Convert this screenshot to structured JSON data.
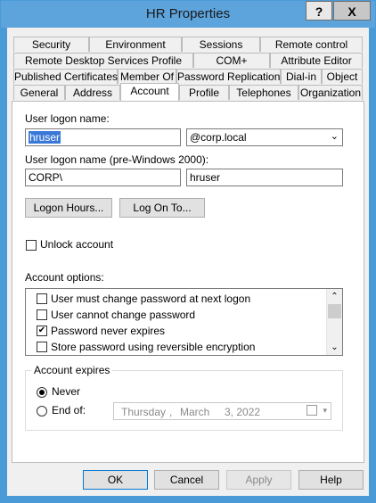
{
  "window": {
    "title": "HR Properties",
    "help_label": "?",
    "close_label": "X"
  },
  "tabs": {
    "row1": [
      "Security",
      "Environment",
      "Sessions",
      "Remote control"
    ],
    "row2": [
      "Remote Desktop Services Profile",
      "COM+",
      "Attribute Editor"
    ],
    "row3": [
      "Published Certificates",
      "Member Of",
      "Password Replication",
      "Dial-in",
      "Object"
    ],
    "row4": [
      "General",
      "Address",
      "Account",
      "Profile",
      "Telephones",
      "Organization"
    ],
    "active": "Account"
  },
  "account": {
    "logon_name_label": "User logon name:",
    "logon_name_value": "hruser",
    "domain_value": "@corp.local",
    "pre2000_label": "User logon name (pre-Windows 2000):",
    "pre2000_domain": "CORP\\",
    "pre2000_user": "hruser",
    "logon_hours_label": "Logon Hours...",
    "log_on_to_label": "Log On To...",
    "unlock_label": "Unlock account",
    "options_label": "Account options:",
    "options": [
      {
        "label": "User must change password at next logon",
        "checked": false
      },
      {
        "label": "User cannot change password",
        "checked": false
      },
      {
        "label": "Password never expires",
        "checked": true
      },
      {
        "label": "Store password using reversible encryption",
        "checked": false
      }
    ],
    "expires_label": "Account expires",
    "never_label": "Never",
    "end_of_label": "End of:",
    "date": {
      "weekday": "Thursday",
      "sep": ",",
      "month": "March",
      "day_year": "3, 2022"
    }
  },
  "footer": {
    "ok": "OK",
    "cancel": "Cancel",
    "apply": "Apply",
    "help": "Help"
  },
  "icons": {
    "checkmark": "✔",
    "chevron_down": "⌄",
    "scroll_up": "⌃",
    "scroll_down": "⌄",
    "cal_drop": "▾"
  }
}
